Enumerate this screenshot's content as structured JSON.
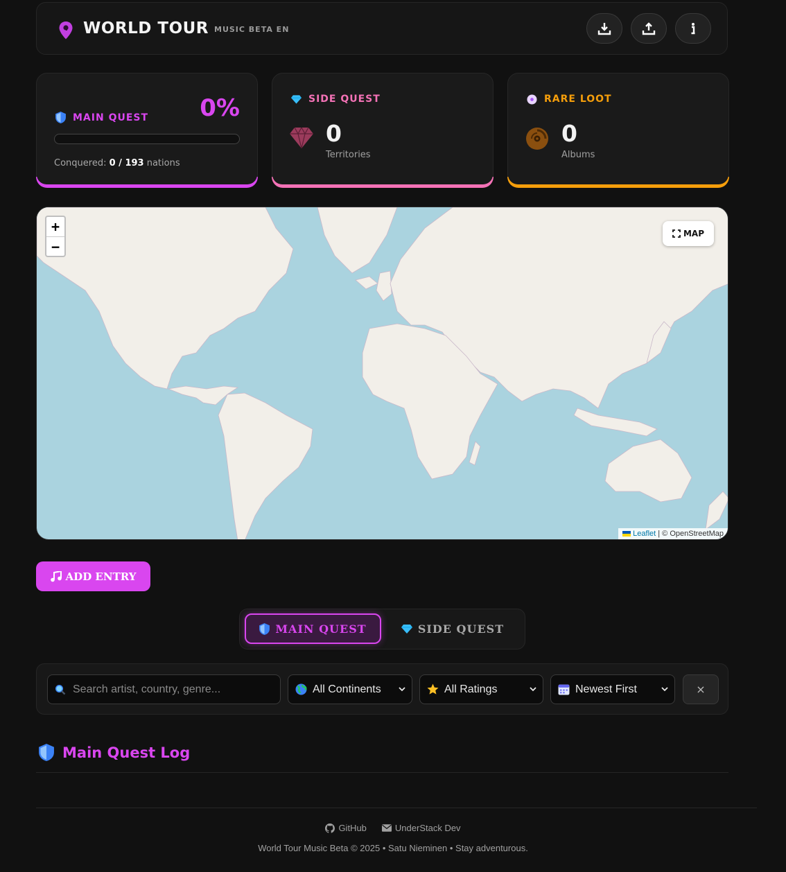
{
  "header": {
    "title": "WORLD TOUR",
    "subtitle": "MUSIC BETA EN",
    "buttons": [
      {
        "icon": "download-icon"
      },
      {
        "icon": "upload-icon"
      },
      {
        "icon": "info-icon"
      }
    ]
  },
  "cards": {
    "main_quest": {
      "title": "MAIN QUEST",
      "percent": "0%",
      "progress": 0,
      "conquered_label": "Conquered:",
      "conquered_value": "0 / 193",
      "conquered_suffix": "nations",
      "accent": "#d946ef"
    },
    "side_quest": {
      "title": "SIDE QUEST",
      "value": "0",
      "label": "Territories",
      "accent": "#f472b6"
    },
    "rare_loot": {
      "title": "RARE LOOT",
      "value": "0",
      "label": "Albums",
      "accent": "#f59e0b"
    }
  },
  "map": {
    "zoom_in": "+",
    "zoom_out": "−",
    "fullscreen_label": "MAP",
    "attribution_leaflet": "Leaflet",
    "attribution_rest": "| © OpenStreetMap"
  },
  "add_entry": "ADD ENTRY",
  "tabs": [
    {
      "label": "MAIN QUEST",
      "active": true
    },
    {
      "label": "SIDE QUEST",
      "active": false
    }
  ],
  "filters": {
    "search_placeholder": "Search artist, country, genre...",
    "continent": "All Continents",
    "rating": "All Ratings",
    "sort": "Newest First",
    "clear": "×"
  },
  "log_title": "Main Quest Log",
  "footer": {
    "github": "GitHub",
    "dev": "UnderStack Dev",
    "copyright": "World Tour Music Beta © 2025 • Satu Nieminen • Stay adventurous."
  }
}
